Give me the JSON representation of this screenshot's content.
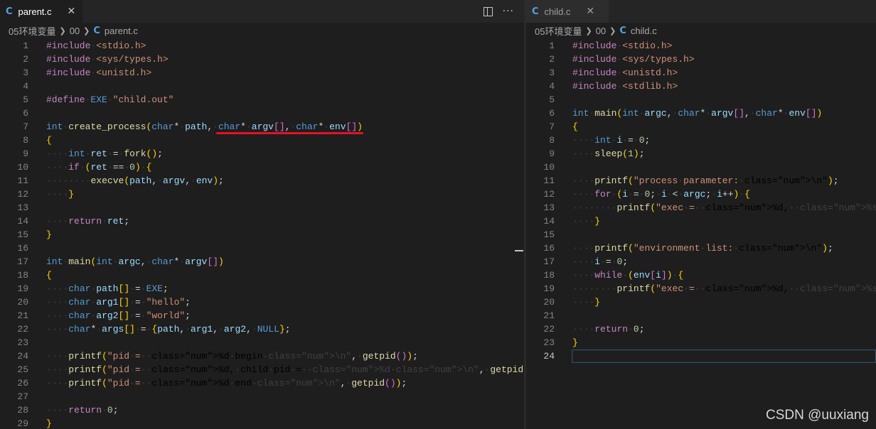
{
  "left_editor": {
    "tab": {
      "label": "parent.c",
      "icon": "c-language-icon"
    },
    "breadcrumb": {
      "folder1": "05环境变量",
      "folder2": "00",
      "file": "parent.c"
    }
  },
  "right_editor": {
    "tab": {
      "label": "child.c",
      "icon": "c-language-icon"
    },
    "breadcrumb": {
      "folder1": "05环境变量",
      "folder2": "00",
      "file": "child.c"
    }
  },
  "watermark": "CSDN @uuxiang",
  "colors": {
    "keyword": "#569cd6",
    "control": "#c586c0",
    "string": "#ce9178",
    "function": "#dcdcaa",
    "variable": "#9cdcfe",
    "number": "#b5cea8",
    "underline": "#e81123"
  },
  "left_code": [
    "#include <stdio.h>",
    "#include <sys/types.h>",
    "#include <unistd.h>",
    "",
    "#define EXE \"child.out\"",
    "",
    "int create_process(char* path, char* argv[], char* env[])",
    "{",
    "    int ret = fork();",
    "    if (ret == 0) {",
    "        execve(path, argv, env);",
    "    }",
    "",
    "    return ret;",
    "}",
    "",
    "int main(int argc, char* argv[])",
    "{",
    "    char path[] = EXE;",
    "    char arg1[] = \"hello\";",
    "    char arg2[] = \"world\";",
    "    char* args[] = {path, arg1, arg2, NULL};",
    "",
    "    printf(\"pid = %d begin\\n\", getpid());",
    "    printf(\"pid = %d, child pid = %d\\n\", getpid(), create_process(EXE, args, args));",
    "    printf(\"pid = %d end\\n\", getpid());",
    "",
    "    return 0;",
    "}"
  ],
  "right_code": [
    "#include <stdio.h>",
    "#include <sys/types.h>",
    "#include <unistd.h>",
    "#include <stdlib.h>",
    "",
    "int main(int argc, char* argv[], char* env[])",
    "{",
    "    int i = 0;",
    "    sleep(1);",
    "",
    "    printf(\"process parameter:\\n\");",
    "    for (i = 0; i < argc; i++) {",
    "        printf(\"exec = %d, %s\\n\", getpid(), argv[i]);",
    "    }",
    "",
    "    printf(\"environment list:\\n\");",
    "    i = 0;",
    "    while (env[i]) {",
    "        printf(\"exec = %d, %s\\n\", getpid(), env[i++]);",
    "    }",
    "",
    "    return 0;",
    "}",
    ""
  ]
}
